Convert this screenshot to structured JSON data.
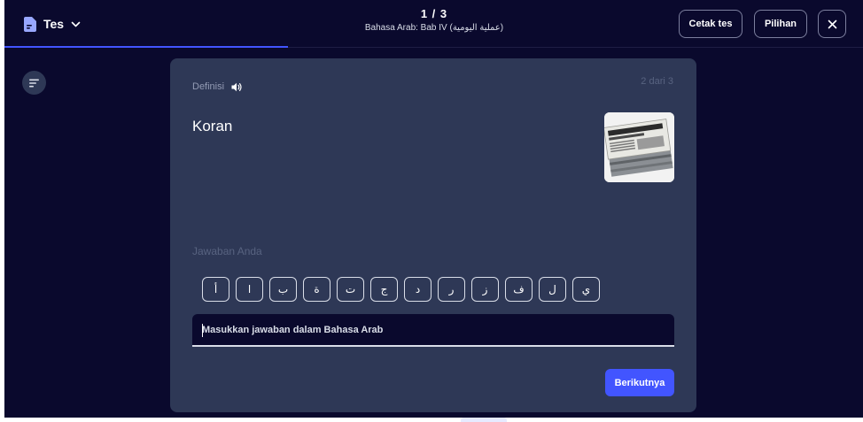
{
  "topbar": {
    "mode_label": "Tes",
    "mode_icon": "document-icon",
    "progress_count": "1 / 3",
    "progress_subtitle": "Bahasa Arab: Bab IV (عملية اليومية)",
    "print_label": "Cetak tes",
    "options_label": "Pilihan",
    "close_icon": "close-icon"
  },
  "sidebar": {
    "toggle_icon": "filter-list-icon"
  },
  "card": {
    "definition_label": "Definisi",
    "audio_icon": "speaker-icon",
    "counter": "2 dari 3",
    "term": "Koran",
    "image_icon": "newspaper-image",
    "answer_label": "Jawaban Anda",
    "characters": [
      "أ",
      "ا",
      "ب",
      "ة",
      "ت",
      "ج",
      "د",
      "ر",
      "ز",
      "ف",
      "ل",
      "ي"
    ],
    "answer_value": "",
    "answer_placeholder": "Masukkan jawaban dalam Bahasa Arab",
    "next_label": "Berikutnya"
  },
  "colors": {
    "background": "#0a092d",
    "card": "#2e3856",
    "accent": "#4255ff",
    "muted_text": "#586380"
  }
}
